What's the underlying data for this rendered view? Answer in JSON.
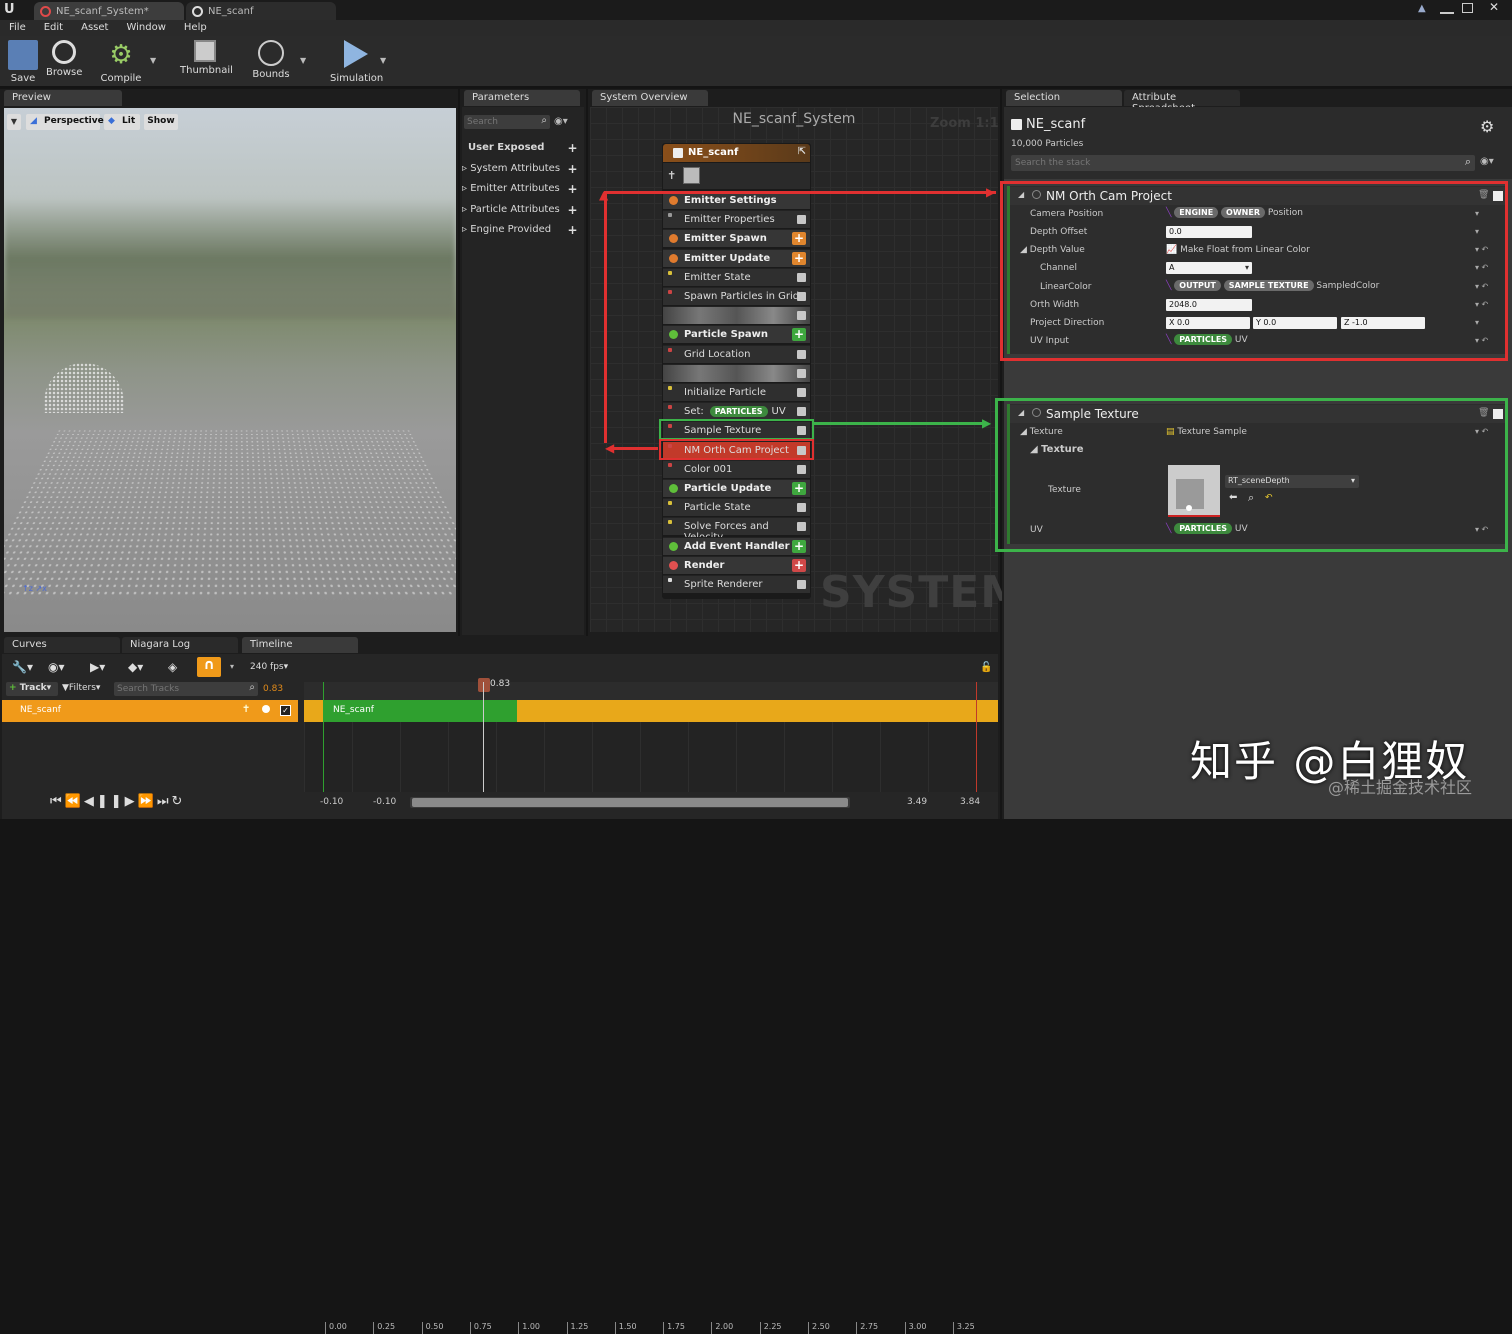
{
  "title_tabs": [
    {
      "label": "NE_scanf_System*"
    },
    {
      "label": "NE_scanf"
    }
  ],
  "menu": [
    "File",
    "Edit",
    "Asset",
    "Window",
    "Help"
  ],
  "toolbar": {
    "save": "Save",
    "browse": "Browse",
    "compile": "Compile",
    "thumbnail": "Thumbnail",
    "bounds": "Bounds",
    "simulation": "Simulation"
  },
  "preview": {
    "tab": "Preview",
    "perspective": "Perspective",
    "lit": "Lit",
    "show": "Show"
  },
  "parameters": {
    "tab": "Parameters",
    "search_placeholder": "Search",
    "items": [
      "User Exposed",
      "System Attributes",
      "Emitter Attributes",
      "Particle Attributes",
      "Engine Provided"
    ]
  },
  "overview": {
    "tab": "System Overview",
    "title": "NE_scanf_System",
    "zoom": "Zoom 1:1",
    "watermark": "SYSTEM",
    "node": {
      "name": "NE_scanf",
      "rows": [
        {
          "label": "Emitter Settings",
          "kind": "hdr",
          "color": "#e07b2e"
        },
        {
          "label": "Emitter Properties",
          "kind": "mod",
          "color": "#999"
        },
        {
          "label": "Emitter Spawn",
          "kind": "hdr",
          "color": "#e07b2e",
          "plus": "#e0862e"
        },
        {
          "label": "Emitter Update",
          "kind": "hdr",
          "color": "#e07b2e",
          "plus": "#e0862e"
        },
        {
          "label": "Emitter State",
          "kind": "mod",
          "color": "#d8c03a"
        },
        {
          "label": "Spawn Particles in Grid",
          "kind": "mod",
          "color": "#c44"
        },
        {
          "label": "",
          "kind": "blur"
        },
        {
          "label": "Particle Spawn",
          "kind": "hdr",
          "color": "#5fbf3a",
          "plus": "#3fa83f"
        },
        {
          "label": "Grid Location",
          "kind": "mod",
          "color": "#c44"
        },
        {
          "label": "",
          "kind": "blur"
        },
        {
          "label": "Initialize Particle",
          "kind": "mod",
          "color": "#d8c03a"
        },
        {
          "label": "Set:",
          "kind": "set",
          "color": "#c44"
        },
        {
          "label": "Sample Texture",
          "kind": "mod",
          "color": "#c44"
        },
        {
          "label": "NM Orth Cam Project",
          "kind": "sel",
          "color": "#c44"
        },
        {
          "label": "Color 001",
          "kind": "mod",
          "color": "#c44"
        },
        {
          "label": "Particle Update",
          "kind": "hdr",
          "color": "#5fbf3a",
          "plus": "#3fa83f"
        },
        {
          "label": "Particle State",
          "kind": "mod",
          "color": "#d8c03a"
        },
        {
          "label": "Solve Forces and Velocity",
          "kind": "mod",
          "color": "#d8c03a"
        },
        {
          "label": "Add Event Handler",
          "kind": "hdr",
          "color": "#5fbf3a",
          "plus": "#3fa83f"
        },
        {
          "label": "Render",
          "kind": "hdr",
          "color": "#e05050",
          "plus": "#d04848"
        },
        {
          "label": "Sprite Renderer",
          "kind": "mod",
          "color": "#ddd"
        }
      ]
    }
  },
  "set_tags": {
    "tag": "PARTICLES",
    "suffix": "UV"
  },
  "selection": {
    "tab": "Selection",
    "tab2": "Attribute Spreadsheet",
    "emitter": "NE_scanf",
    "particles": "10,000 Particles",
    "search_placeholder": "Search the stack",
    "orth": {
      "title": "NM Orth Cam Project",
      "camera_position": "Camera Position",
      "cp_tags": [
        "ENGINE",
        "OWNER"
      ],
      "cp_value": "Position",
      "depth_offset": "Depth Offset",
      "depth_offset_val": "0.0",
      "depth_value": "Depth Value",
      "depth_value_fn": "Make Float from Linear Color",
      "channel": "Channel",
      "channel_val": "A",
      "linear_color": "LinearColor",
      "lc_tags": [
        "OUTPUT",
        "SAMPLE TEXTURE"
      ],
      "lc_value": "SampledColor",
      "orth_width": "Orth Width",
      "orth_width_val": "2048.0",
      "project_direction": "Project Direction",
      "pd_x": "X 0.0",
      "pd_y": "Y 0.0",
      "pd_z": "Z -1.0",
      "uv_input": "UV Input",
      "uv_tag": "PARTICLES",
      "uv_val": "UV"
    },
    "sample": {
      "title": "Sample Texture",
      "texture": "Texture",
      "texture_fn": "Texture Sample",
      "texture_sub": "Texture",
      "texture_label": "Texture",
      "texture_asset": "RT_sceneDepth",
      "uv": "UV",
      "uv_tag": "PARTICLES",
      "uv_val": "UV"
    }
  },
  "bottom": {
    "tabs": [
      "Curves",
      "Niagara Log",
      "Timeline"
    ],
    "fps": "240 fps",
    "track": "Track",
    "filters": "Filters",
    "search_placeholder": "Search Tracks",
    "time": "0.83",
    "track_name": "NE_scanf",
    "bar_label": "NE_scanf",
    "ticks": [
      "0.00",
      "0.25",
      "0.50",
      "0.75",
      "1.00",
      "1.25",
      "1.50",
      "1.75",
      "2.00",
      "2.25",
      "2.50",
      "2.75",
      "3.00",
      "3.25"
    ],
    "range_start": "-0.10",
    "range_start2": "-0.10",
    "range_end": "3.49",
    "range_end2": "3.84"
  },
  "watermark": {
    "main": "知乎 @白狸奴",
    "sub": "@稀土掘金技术社区"
  },
  "colors": {
    "accent_orange": "#f09a1a",
    "highlight_red": "#e03030",
    "highlight_green": "#3cb34a"
  }
}
